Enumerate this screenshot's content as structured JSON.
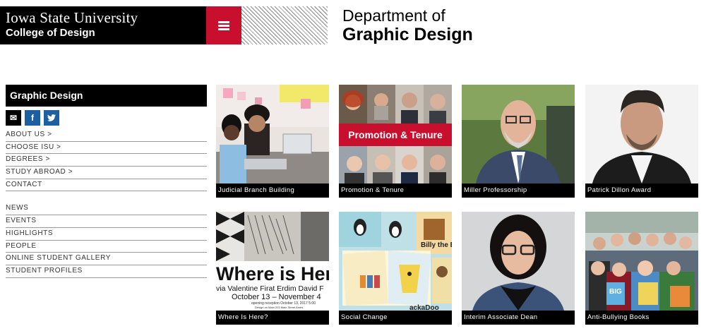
{
  "header": {
    "university": "Iowa State University",
    "college": "College of Design",
    "menu_icon": "hamburger-icon",
    "department_top": "Department of",
    "department_bottom": "Graphic Design"
  },
  "sidebar": {
    "title": "Graphic Design",
    "social": [
      {
        "icon": "mail-icon",
        "label": "✉"
      },
      {
        "icon": "facebook-icon",
        "label": "f"
      },
      {
        "icon": "twitter-icon",
        "label": "t"
      }
    ],
    "primary_links": [
      "ABOUT US >",
      "CHOOSE ISU >",
      "DEGREES >",
      "STUDY ABROAD >",
      "CONTACT"
    ],
    "secondary_links": [
      "NEWS",
      "EVENTS",
      "HIGHLIGHTS",
      "PEOPLE",
      "ONLINE STUDENT GALLERY",
      "STUDENT PROFILES"
    ]
  },
  "tiles": [
    {
      "caption": "Judicial Branch Building"
    },
    {
      "caption": "Promotion & Tenure",
      "overlay": "Promotion & Tenure"
    },
    {
      "caption": "Miller Professorship"
    },
    {
      "caption": "Patrick Dillon Award"
    },
    {
      "caption": "Where Is Here?",
      "poster_title": "Where is Her",
      "poster_names": "via Valentine Firat Erdim David F",
      "poster_dates": "October 13 – November 4",
      "poster_reception": "opening reception October 13, 2017 5:00",
      "poster_location": "Design on Main 203 Main Street Ames"
    },
    {
      "caption": "Social Change",
      "book_label": "Billy the Be",
      "book_bottom": "ackaDoo"
    },
    {
      "caption": "Interim Associate Dean"
    },
    {
      "caption": "Anti-Bullying Books",
      "book_title": "BIG"
    }
  ],
  "colors": {
    "isu_red": "#c8102e",
    "black": "#000000",
    "social_blue": "#1d5fa0"
  }
}
